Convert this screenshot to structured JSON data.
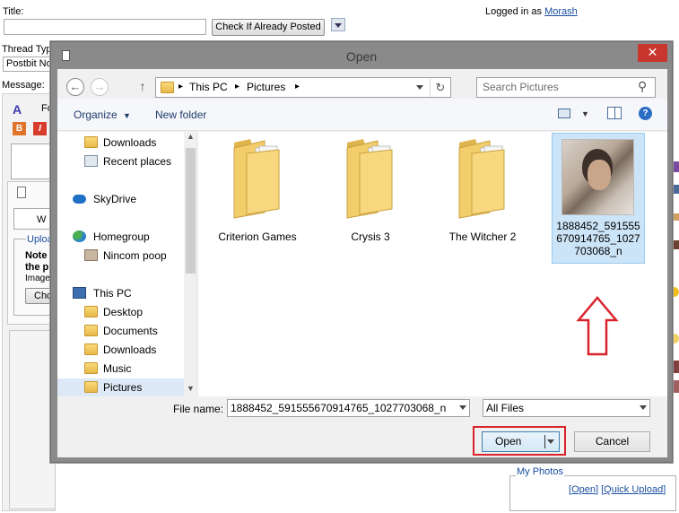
{
  "page": {
    "title_label": "Title:",
    "check_button": "Check If Already Posted",
    "logged_in_prefix": "Logged in as",
    "username": "Morash",
    "thread_type_label": "Thread Typ",
    "thread_type_value": "Postbit No",
    "message_label": "Message:",
    "upload_label": "Uploa",
    "note_text": "Note",
    "note_text2": "the p",
    "image_label": "Image",
    "choose_label": "Cho",
    "my_photos_label": "My Photos",
    "open_link": "Open",
    "quick_upload_link": "Quick Upload",
    "ww_label": "W",
    "fo_label": "Fo"
  },
  "dialog": {
    "title": "Open",
    "close_symbol": "✕",
    "breadcrumb": [
      "This PC",
      "Pictures"
    ],
    "search_placeholder": "Search Pictures",
    "toolbar": {
      "organize": "Organize",
      "new_folder": "New folder"
    },
    "nav": [
      {
        "label": "Downloads",
        "icon": "downloads-folder-icon"
      },
      {
        "label": "Recent places",
        "icon": "recent-places-icon"
      },
      {
        "label": "SkyDrive",
        "icon": "skydrive-icon"
      },
      {
        "label": "Homegroup",
        "icon": "homegroup-icon"
      },
      {
        "label": "Nincom poop",
        "icon": "user-icon"
      },
      {
        "label": "This PC",
        "icon": "computer-icon"
      },
      {
        "label": "Desktop",
        "icon": "desktop-folder-icon"
      },
      {
        "label": "Documents",
        "icon": "documents-folder-icon"
      },
      {
        "label": "Downloads",
        "icon": "downloads-folder-icon"
      },
      {
        "label": "Music",
        "icon": "music-folder-icon"
      },
      {
        "label": "Pictures",
        "icon": "pictures-folder-icon"
      }
    ],
    "files": [
      {
        "name": "Criterion Games",
        "type": "folder"
      },
      {
        "name": "Crysis 3",
        "type": "folder"
      },
      {
        "name": "The Witcher 2",
        "type": "folder"
      },
      {
        "name": "1888452_591555670914765_1027703068_n",
        "type": "image"
      }
    ],
    "file_name_label": "File name:",
    "file_name_value": "1888452_591555670914765_1027703068_n",
    "file_type_value": "All Files",
    "open_button": "Open",
    "cancel_button": "Cancel"
  },
  "colors": {
    "highlight_red": "#d9232a",
    "selection_blue": "#cce4f7",
    "close_red": "#c7372e"
  }
}
